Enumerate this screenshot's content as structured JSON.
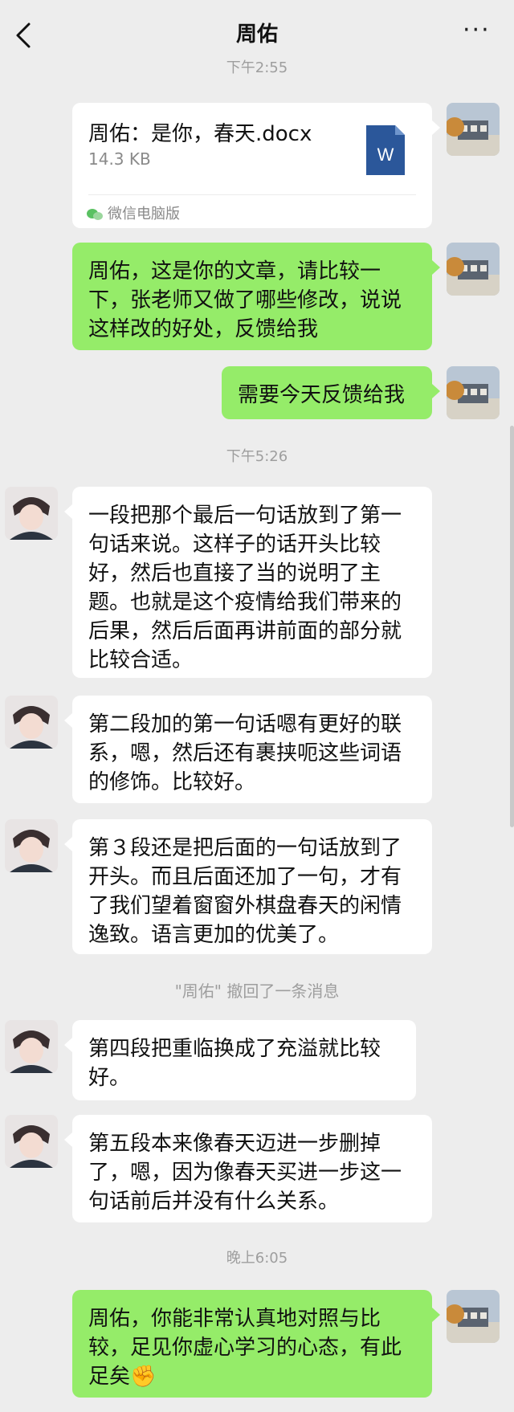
{
  "header": {
    "title": "周佑",
    "more_label": "···"
  },
  "timestamps": [
    "下午2:55",
    "下午5:26",
    "晚上6:05"
  ],
  "file": {
    "name": "周佑：是你，春天.docx",
    "size": "14.3 KB",
    "source": "微信电脑版",
    "icon_letter": "W"
  },
  "messages_sent": [
    "周佑，这是你的文章，请比较一下，张老师又做了哪些修改，说说这样改的好处，反馈给我",
    "需要今天反馈给我",
    "周佑，你能非常认真地对照与比较，足见你虚心学习的心态，有此足矣✊"
  ],
  "messages_received": [
    "一段把那个最后一句话放到了第一句话来说。这样子的话开头比较好，然后也直接了当的说明了主题。也就是这个疫情给我们带来的后果，然后后面再讲前面的部分就比较合适。",
    "第二段加的第一句话嗯有更好的联系，嗯，然后还有裹挟呃这些词语的修饰。比较好。",
    "第３段还是把后面的一句话放到了开头。而且后面还加了一句，才有了我们望着窗窗外棋盘春天的闲情逸致。语言更加的优美了。",
    "第四段把重临换成了充溢就比较好。",
    "第五段本来像春天迈进一步删掉了，嗯，因为像春天买进一步这一句话前后并没有什么关系。"
  ],
  "system_note": "\"周佑\" 撤回了一条消息",
  "colors": {
    "background": "#ededed",
    "sent_bubble": "#95ec69",
    "received_bubble": "#ffffff",
    "word_icon": "#2b579a"
  }
}
